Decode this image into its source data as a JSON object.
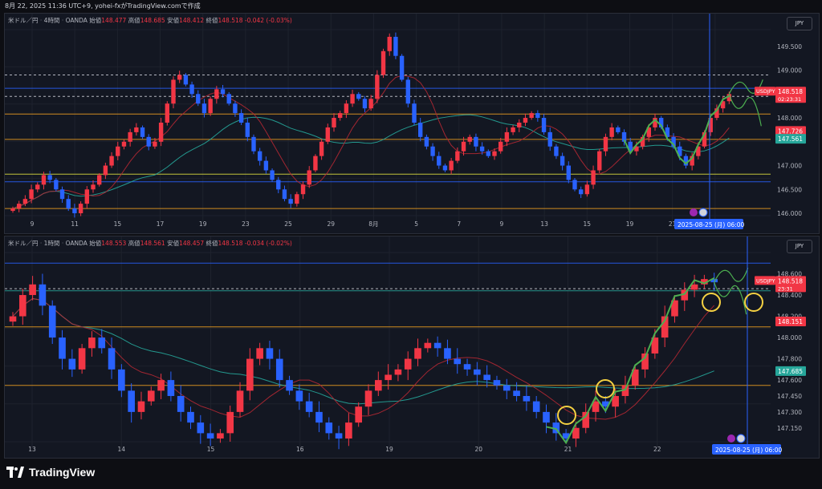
{
  "header": {
    "date_time": "8月 22, 2025 11:36 UTC+9",
    "author_note": "yohei-fxがTradingView.comで作成"
  },
  "colors": {
    "bull": "#f23645",
    "bear": "#2962ff",
    "grid": "#1e222d",
    "bg": "#131722"
  },
  "chart_data": [
    {
      "type": "candlestick",
      "symbol": "米ドル／円",
      "timeframe": "4時間",
      "source": "OANDA",
      "ohlc_labels": {
        "open": "始値",
        "high": "高値",
        "low": "安値",
        "close": "終値"
      },
      "ohlc": {
        "open": "148.477",
        "high": "148.685",
        "low": "148.412",
        "close": "148.518",
        "change": "-0.042 (-0.03%)"
      },
      "unit_button": "JPY",
      "y_ticks": [
        "149.500",
        "149.000",
        "148.000",
        "147.000",
        "146.500",
        "146.000"
      ],
      "y_range": [
        145.95,
        149.85
      ],
      "x_ticks": [
        "9",
        "11",
        "15",
        "17",
        "19",
        "23",
        "25",
        "29",
        "8月",
        "5",
        "7",
        "9",
        "13",
        "15",
        "19",
        "21",
        "7"
      ],
      "price_tag": {
        "symbol": "USDJPY",
        "price": "148.518",
        "countdown": "02:23:31"
      },
      "level_tags": [
        "147.726",
        "147.561"
      ],
      "time_tag": {
        "date": "2025-08-25 (月)",
        "time": "06:00"
      },
      "horizontal_levels": [
        148.9,
        148.62,
        148.45,
        148.08,
        147.55,
        146.82,
        146.66,
        146.1
      ],
      "close_series": [
        146.1,
        146.2,
        146.3,
        146.5,
        146.6,
        146.8,
        146.7,
        146.5,
        146.3,
        146.1,
        146.0,
        146.2,
        146.5,
        146.6,
        146.8,
        147.0,
        147.2,
        147.4,
        147.5,
        147.7,
        147.8,
        147.6,
        147.4,
        147.5,
        147.9,
        148.3,
        148.8,
        148.9,
        148.7,
        148.5,
        148.3,
        148.1,
        148.4,
        148.6,
        148.5,
        148.3,
        148.1,
        147.9,
        147.6,
        147.3,
        147.1,
        146.9,
        146.7,
        146.5,
        146.3,
        146.2,
        146.4,
        146.6,
        146.9,
        147.2,
        147.5,
        147.8,
        148.0,
        148.1,
        148.3,
        148.5,
        148.4,
        148.2,
        148.4,
        148.9,
        149.4,
        149.7,
        149.3,
        148.8,
        148.3,
        147.9,
        147.6,
        147.4,
        147.2,
        147.0,
        146.9,
        147.1,
        147.3,
        147.5,
        147.6,
        147.4,
        147.3,
        147.2,
        147.3,
        147.5,
        147.7,
        147.8,
        147.9,
        148.0,
        148.1,
        148.0,
        147.7,
        147.4,
        147.2,
        147.0,
        146.7,
        146.5,
        146.4,
        146.6,
        146.9,
        147.3,
        147.6,
        147.8,
        147.7,
        147.5,
        147.3,
        147.4,
        147.6,
        147.8,
        148.0,
        147.8,
        147.6,
        147.4,
        147.2,
        147.0,
        147.2,
        147.4,
        147.7,
        148.0,
        148.2,
        148.35,
        148.5
      ]
    },
    {
      "type": "candlestick",
      "symbol": "米ドル／円",
      "timeframe": "1時間",
      "source": "OANDA",
      "ohlc_labels": {
        "open": "始値",
        "high": "高値",
        "low": "安値",
        "close": "終値"
      },
      "ohlc": {
        "open": "148.553",
        "high": "148.561",
        "low": "148.457",
        "close": "148.518",
        "change": "-0.034 (-0.02%)"
      },
      "unit_button": "JPY",
      "y_ticks": [
        "148.600",
        "148.400",
        "148.200",
        "148.000",
        "147.800",
        "147.600",
        "147.450",
        "147.300",
        "147.150"
      ],
      "y_range": [
        147.02,
        148.8
      ],
      "x_ticks": [
        "13",
        "14",
        "15",
        "16",
        "19",
        "20",
        "21",
        "22"
      ],
      "price_tag": {
        "symbol": "USDJPY",
        "price": "148.518",
        "countdown": "23:31"
      },
      "level_tags": [
        "148.151",
        "147.685"
      ],
      "time_tag": {
        "date": "2025-08-25 (月)",
        "time": "06:00"
      },
      "horizontal_levels": [
        148.7,
        148.46,
        148.44,
        148.1,
        147.55
      ],
      "close_series": [
        148.2,
        148.4,
        148.5,
        148.3,
        148.0,
        147.8,
        147.7,
        147.9,
        148.0,
        147.9,
        147.7,
        147.5,
        147.3,
        147.4,
        147.5,
        147.6,
        147.45,
        147.3,
        147.2,
        147.1,
        147.05,
        147.1,
        147.3,
        147.5,
        147.8,
        147.9,
        147.8,
        147.6,
        147.5,
        147.4,
        147.3,
        147.2,
        147.1,
        147.05,
        147.2,
        147.35,
        147.5,
        147.6,
        147.65,
        147.7,
        147.8,
        147.9,
        147.95,
        147.9,
        147.8,
        147.75,
        147.7,
        147.65,
        147.6,
        147.55,
        147.5,
        147.45,
        147.4,
        147.3,
        147.2,
        147.1,
        147.05,
        147.15,
        147.3,
        147.4,
        147.35,
        147.45,
        147.55,
        147.7,
        147.85,
        148.0,
        148.2,
        148.35,
        148.45,
        148.5,
        148.55,
        148.52
      ]
    }
  ],
  "logo": {
    "text": "TradingView"
  }
}
